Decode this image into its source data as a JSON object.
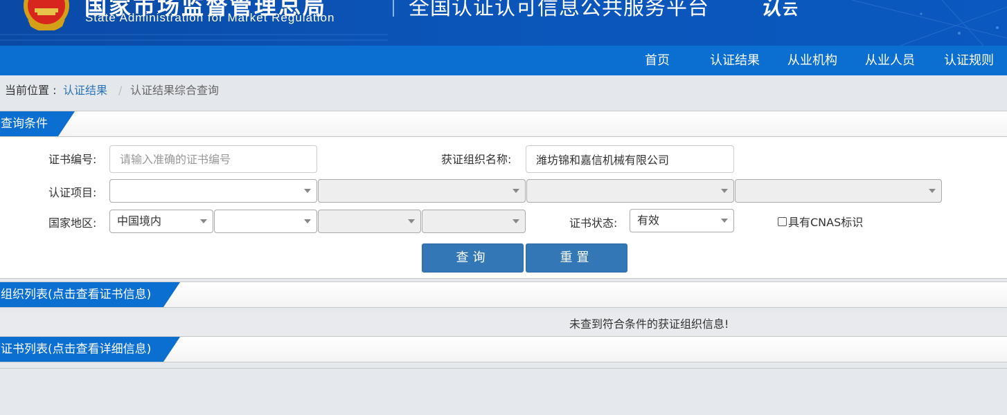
{
  "header": {
    "agency_cn": "国家市场监督管理总局",
    "agency_en": "State Administration  for  Market Regulation",
    "platform_title": "全国认证认可信息公共服务平台",
    "logo_text": "认",
    "logo_suffix": "云",
    "brand_color": "#0a55b8"
  },
  "nav": {
    "items": [
      "首页",
      "认证结果",
      "从业机构",
      "从业人员",
      "认证规则"
    ],
    "bar_color": "#0a6fd0"
  },
  "breadcrumb": {
    "label": "当前位置 :",
    "link": "认证结果",
    "separator": "/",
    "current": "认证结果综合查询"
  },
  "query": {
    "title": "查询条件",
    "cert_no_label": "证书编号:",
    "cert_no_placeholder": "请输入准确的证书编号",
    "cert_no_value": "",
    "org_name_label": "获证组织名称:",
    "org_name_value": "潍坊锦和嘉信机械有限公司",
    "project_label": "认证项目:",
    "project_selects": [
      "",
      "",
      "",
      ""
    ],
    "region_label": "国家地区:",
    "region_selects": [
      "中国境内",
      "",
      "",
      ""
    ],
    "status_label": "证书状态:",
    "status_value": "有效",
    "cnas_label": "具有CNAS标识",
    "search_button": "查询",
    "reset_button": "重置",
    "button_color": "#3377b6"
  },
  "org_list": {
    "title": "组织列表(点击查看证书信息)",
    "empty_message": "未查到符合条件的获证组织信息!"
  },
  "cert_list": {
    "title": "证书列表(点击查看详细信息)"
  }
}
